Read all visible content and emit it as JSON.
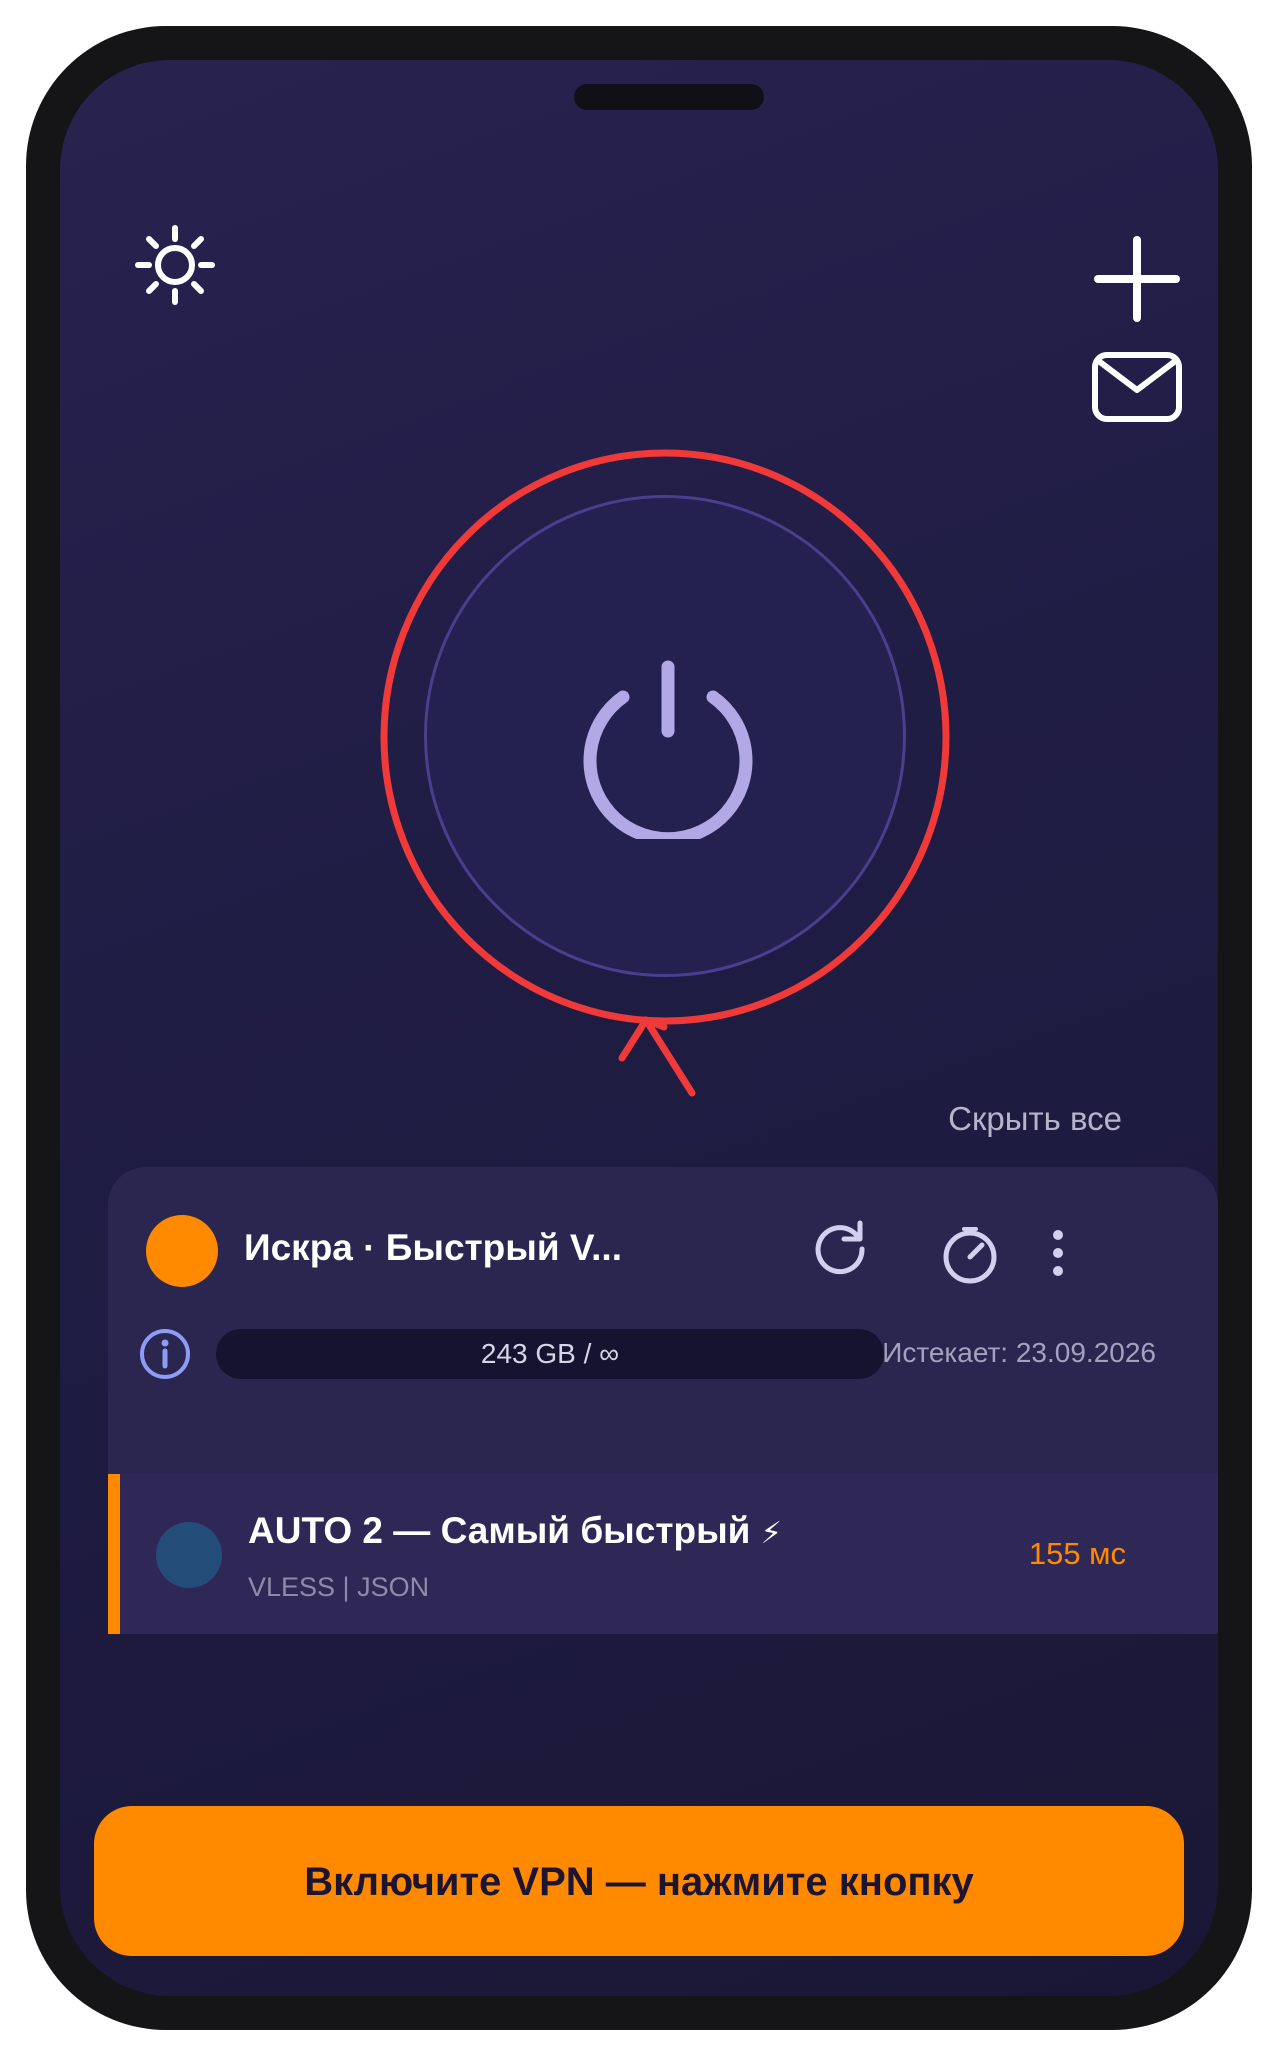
{
  "header": {
    "settings_icon": "sun-gear-icon",
    "add_icon": "plus-icon",
    "mail_icon": "envelope-icon"
  },
  "power": {
    "icon": "power-icon",
    "annotation_color": "#f03a3a"
  },
  "list_controls": {
    "hide_all_label": "Скрыть все"
  },
  "subscription": {
    "title": "Искра · Быстрый V...",
    "status_color": "#ff8a00",
    "refresh_icon": "refresh-icon",
    "speedtest_icon": "speedometer-icon",
    "more_icon": "more-vertical-icon",
    "info_icon": "info-icon",
    "traffic": "243 GB / ∞",
    "expires": "Истекает: 23.09.2026"
  },
  "servers": [
    {
      "name": "AUTO 2 — Самый быстрый",
      "badge": "⚡",
      "protocol": "VLESS | JSON",
      "ping": "155 мс",
      "selected": true,
      "dot_color": "#244c78"
    }
  ],
  "cta": {
    "label": "Включите VPN — нажмите кнопку",
    "color": "#ff8a00"
  },
  "colors": {
    "accent": "#ff8a00",
    "background": "#221e48",
    "card": "#2b2650",
    "power_stroke": "#b3a8e6"
  }
}
